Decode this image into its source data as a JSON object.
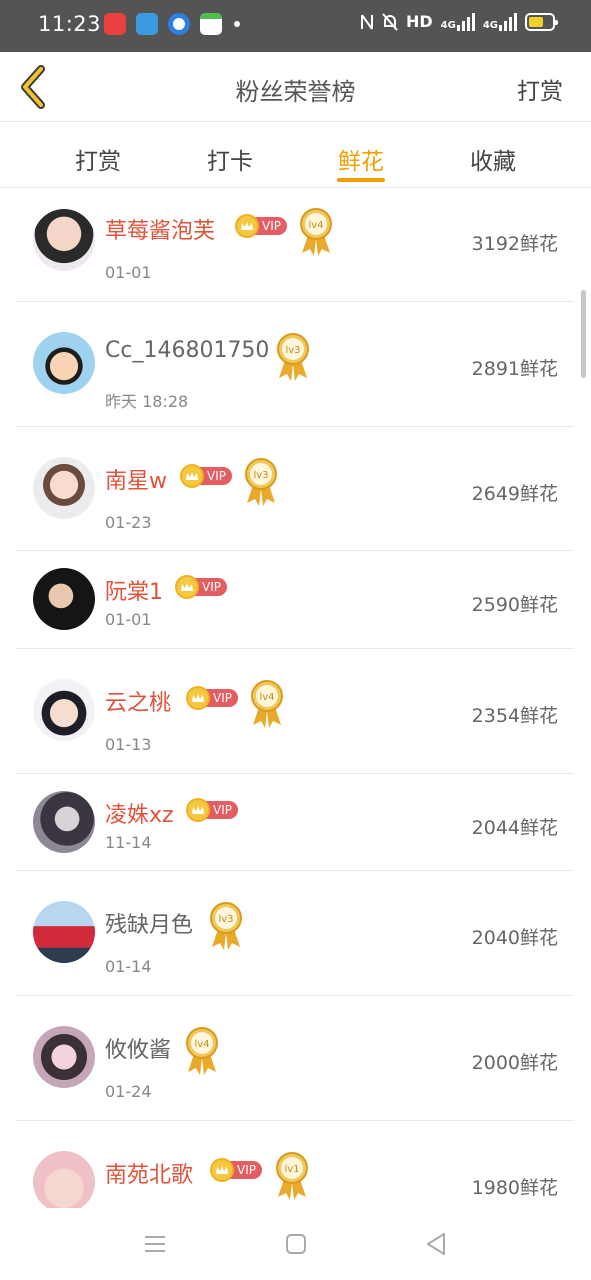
{
  "status_bar": {
    "time": "11:23",
    "network": "HD",
    "signal1_label": "4G",
    "signal2_label": "4G",
    "app_icons": [
      "red-app-icon",
      "telegram-icon",
      "browser-icon",
      "mail-app-icon"
    ],
    "battery_color": "#f2d02c"
  },
  "header": {
    "title": "粉丝荣誉榜",
    "action_label": "打赏"
  },
  "tabs": [
    {
      "label": "打赏",
      "active": false
    },
    {
      "label": "打卡",
      "active": false
    },
    {
      "label": "鲜花",
      "active": true
    },
    {
      "label": "收藏",
      "active": false
    }
  ],
  "accent_color": "#f0a000",
  "vip_label": "VIP",
  "rows": [
    {
      "name": "草莓酱泡芙",
      "vip": true,
      "level": "lv4",
      "date": "01-01",
      "value": "3192鲜花"
    },
    {
      "name": "Cc_146801750",
      "vip": false,
      "level": "lv3",
      "date": "昨天 18:28",
      "value": "2891鲜花"
    },
    {
      "name": "南星w",
      "vip": true,
      "level": "lv3",
      "date": "01-23",
      "value": "2649鲜花"
    },
    {
      "name": "阮棠1",
      "vip": true,
      "level": "",
      "date": "01-01",
      "value": "2590鲜花"
    },
    {
      "name": "云之桃",
      "vip": true,
      "level": "lv4",
      "date": "01-13",
      "value": "2354鲜花"
    },
    {
      "name": "凌姝xz",
      "vip": true,
      "level": "",
      "date": "11-14",
      "value": "2044鲜花"
    },
    {
      "name": "残缺月色",
      "vip": false,
      "level": "lv3",
      "date": "01-14",
      "value": "2040鲜花"
    },
    {
      "name": "攸攸酱",
      "vip": false,
      "level": "lv4",
      "date": "01-24",
      "value": "2000鲜花"
    },
    {
      "name": "南苑北歌",
      "vip": true,
      "level": "lv1",
      "date": "",
      "value": "1980鲜花"
    }
  ],
  "nav_bar": [
    "menu-icon",
    "home-icon",
    "back-icon"
  ]
}
